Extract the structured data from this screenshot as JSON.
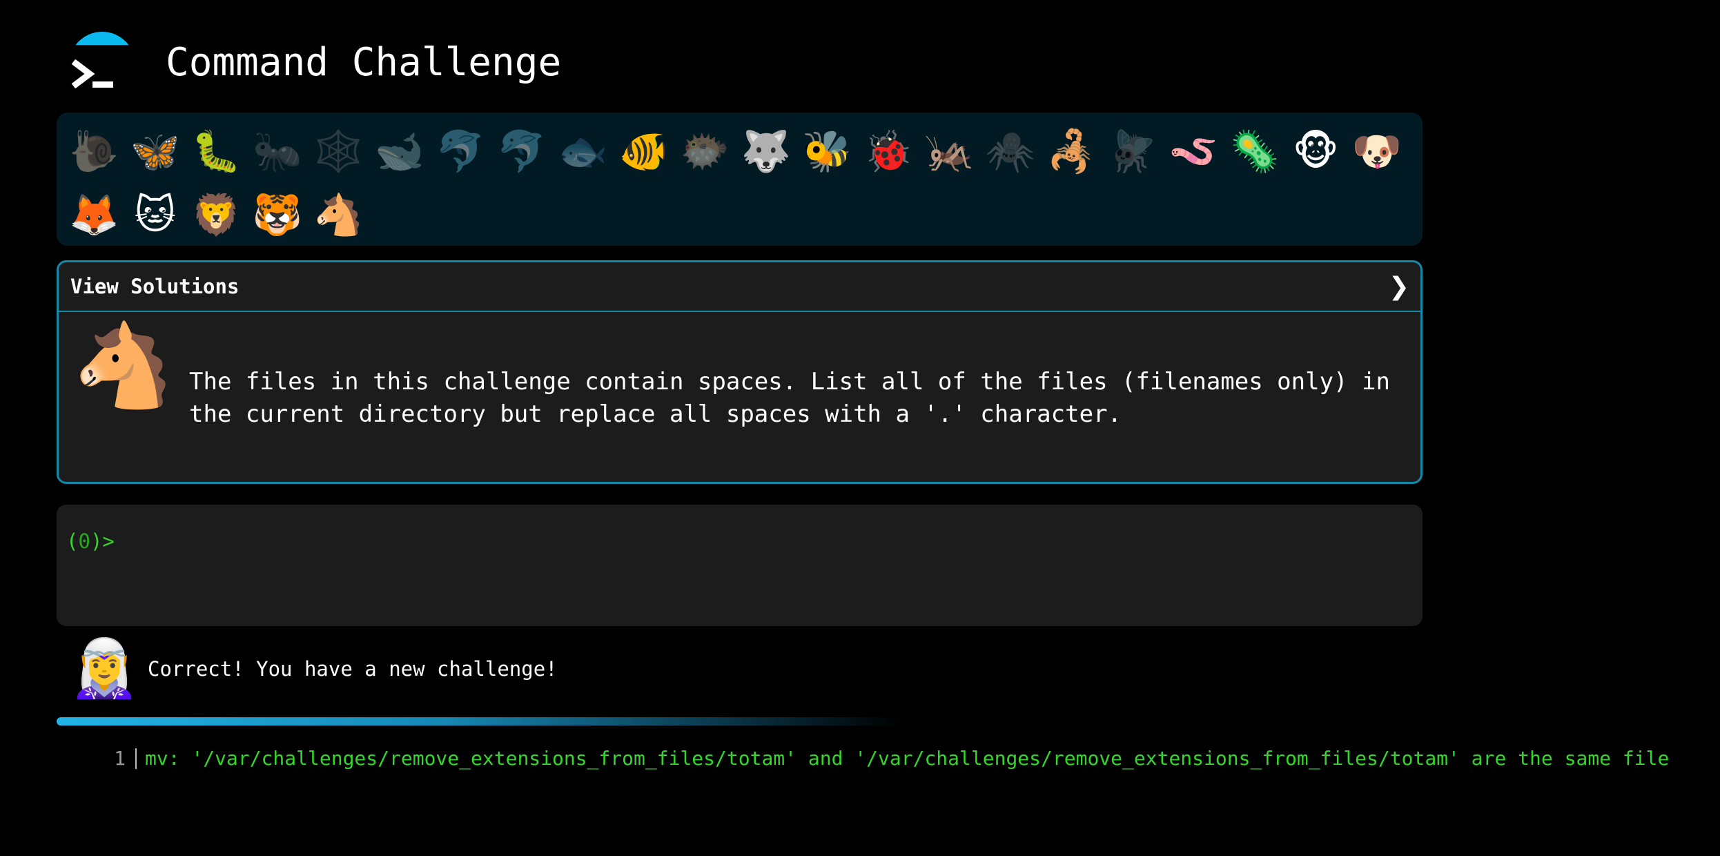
{
  "app": {
    "title": "Command Challenge",
    "accent_color": "#0bbbf0"
  },
  "animals": [
    {
      "icon": "🐌",
      "name": "snail-icon",
      "dim": true
    },
    {
      "icon": "🦋",
      "name": "butterfly-icon",
      "dim": false
    },
    {
      "icon": "🐛",
      "name": "caterpillar-icon",
      "dim": false
    },
    {
      "icon": "🐜",
      "name": "ant-icon",
      "dim": true
    },
    {
      "icon": "🕸️",
      "name": "spider-web-icon",
      "dim": true
    },
    {
      "icon": "🐋",
      "name": "whale-icon",
      "dim": true
    },
    {
      "icon": "🐬",
      "name": "dolphin-icon",
      "dim": true
    },
    {
      "icon": "🐬",
      "name": "dolphin-grey-icon",
      "dim": true
    },
    {
      "icon": "🐟",
      "name": "fish-icon",
      "dim": true
    },
    {
      "icon": "🐠",
      "name": "tropical-fish-icon",
      "dim": false
    },
    {
      "icon": "🐡",
      "name": "blowfish-icon",
      "dim": true
    },
    {
      "icon": "🐺",
      "name": "wolf-icon",
      "dim": false
    },
    {
      "icon": "🐝",
      "name": "bee-icon",
      "dim": false
    },
    {
      "icon": "🐞",
      "name": "ladybug-icon",
      "dim": false
    },
    {
      "icon": "🦗",
      "name": "cricket-icon",
      "dim": false
    },
    {
      "icon": "🕷️",
      "name": "spider-icon",
      "dim": true
    },
    {
      "icon": "🦂",
      "name": "scorpion-icon",
      "dim": false
    },
    {
      "icon": "🪰",
      "name": "fly-icon",
      "dim": true
    },
    {
      "icon": "🪱",
      "name": "worm-icon",
      "dim": false
    },
    {
      "icon": "🦠",
      "name": "microbe-icon",
      "dim": false
    },
    {
      "icon": "🐵",
      "name": "monkey-icon",
      "dim": false
    },
    {
      "icon": "🐶",
      "name": "dog-icon",
      "dim": false
    },
    {
      "icon": "🦊",
      "name": "fox-icon",
      "dim": false
    },
    {
      "icon": "🐱",
      "name": "cat-icon",
      "dim": false
    },
    {
      "icon": "🦁",
      "name": "lion-icon",
      "dim": false
    },
    {
      "icon": "🐯",
      "name": "tiger-icon",
      "dim": false
    },
    {
      "icon": "🐴",
      "name": "horse-icon",
      "dim": false
    }
  ],
  "solutions": {
    "header_label": "View Solutions",
    "chevron": "❯",
    "animal_icon": "🐴",
    "description": "The files in this challenge contain spaces. List all of the files (filenames only) in the current directory but replace all spaces with a '.' character."
  },
  "terminal": {
    "prompt_open": "(",
    "prompt_count": "0",
    "prompt_close": ")>"
  },
  "feedback": {
    "icon": "🧝‍♀️",
    "message": "Correct! You have a new challenge!"
  },
  "progress": {
    "fraction": 0.47
  },
  "output": {
    "line_number": "1",
    "text": "mv: '/var/challenges/remove_extensions_from_files/totam' and '/var/challenges/remove_extensions_from_files/totam' are the same file"
  }
}
